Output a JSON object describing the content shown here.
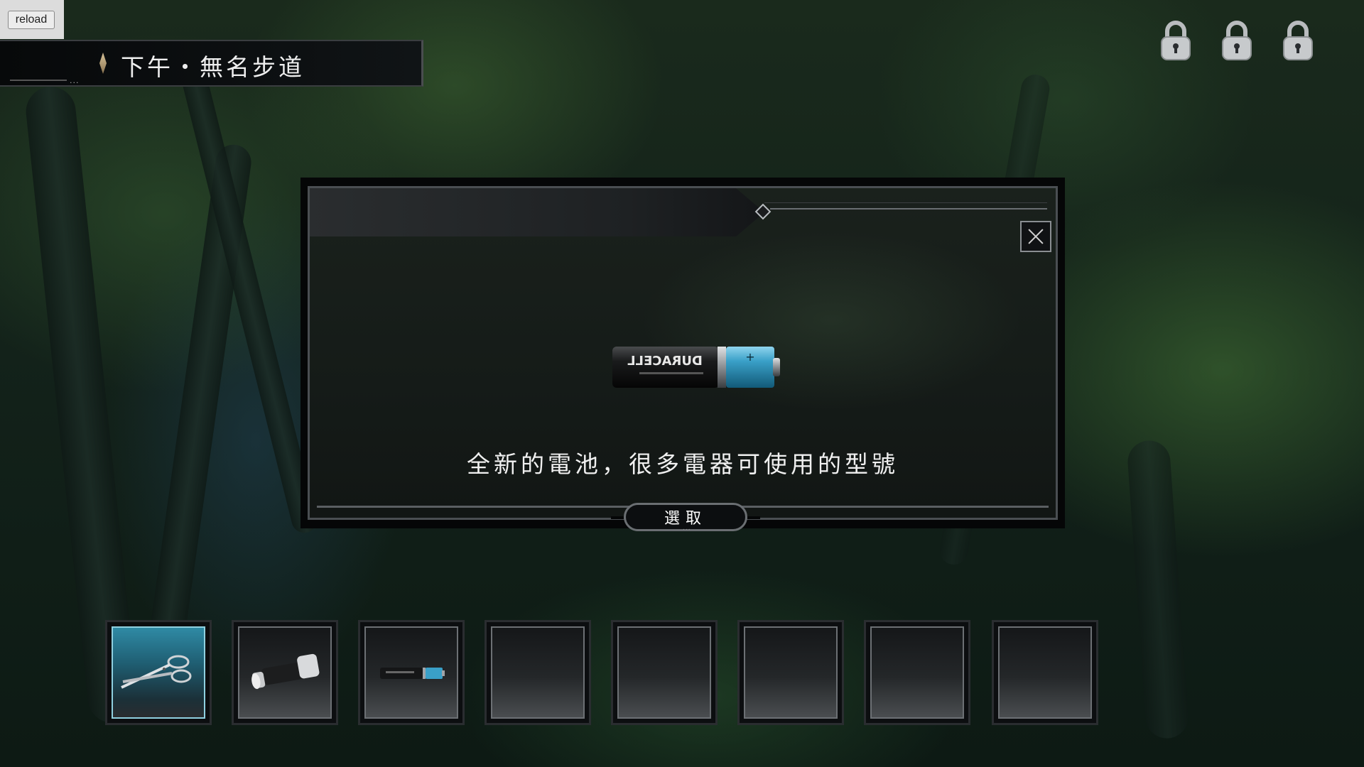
{
  "reload_label": "reload",
  "location": {
    "text": "下午・無名步道",
    "dots": "..."
  },
  "top_right_locks": [
    {
      "icon": "padlock-icon"
    },
    {
      "icon": "padlock-icon"
    },
    {
      "icon": "padlock-icon"
    }
  ],
  "dialog": {
    "item_image": "battery-icon",
    "battery_print": "DURACELL",
    "description": "全新的電池，很多電器可使用的型號",
    "select_label": "選取",
    "close_icon": "close-icon"
  },
  "inventory": {
    "slots": [
      {
        "item": "scissors-icon",
        "selected": true
      },
      {
        "item": "flashlight-icon",
        "selected": false
      },
      {
        "item": "battery-icon",
        "selected": false
      },
      {
        "item": null,
        "selected": false
      },
      {
        "item": null,
        "selected": false
      },
      {
        "item": null,
        "selected": false
      },
      {
        "item": null,
        "selected": false
      },
      {
        "item": null,
        "selected": false
      }
    ]
  },
  "colors": {
    "selected_slot": "#2f8aa5",
    "battery_blue": "#3aa0c8",
    "text": "#f0f0f0"
  }
}
